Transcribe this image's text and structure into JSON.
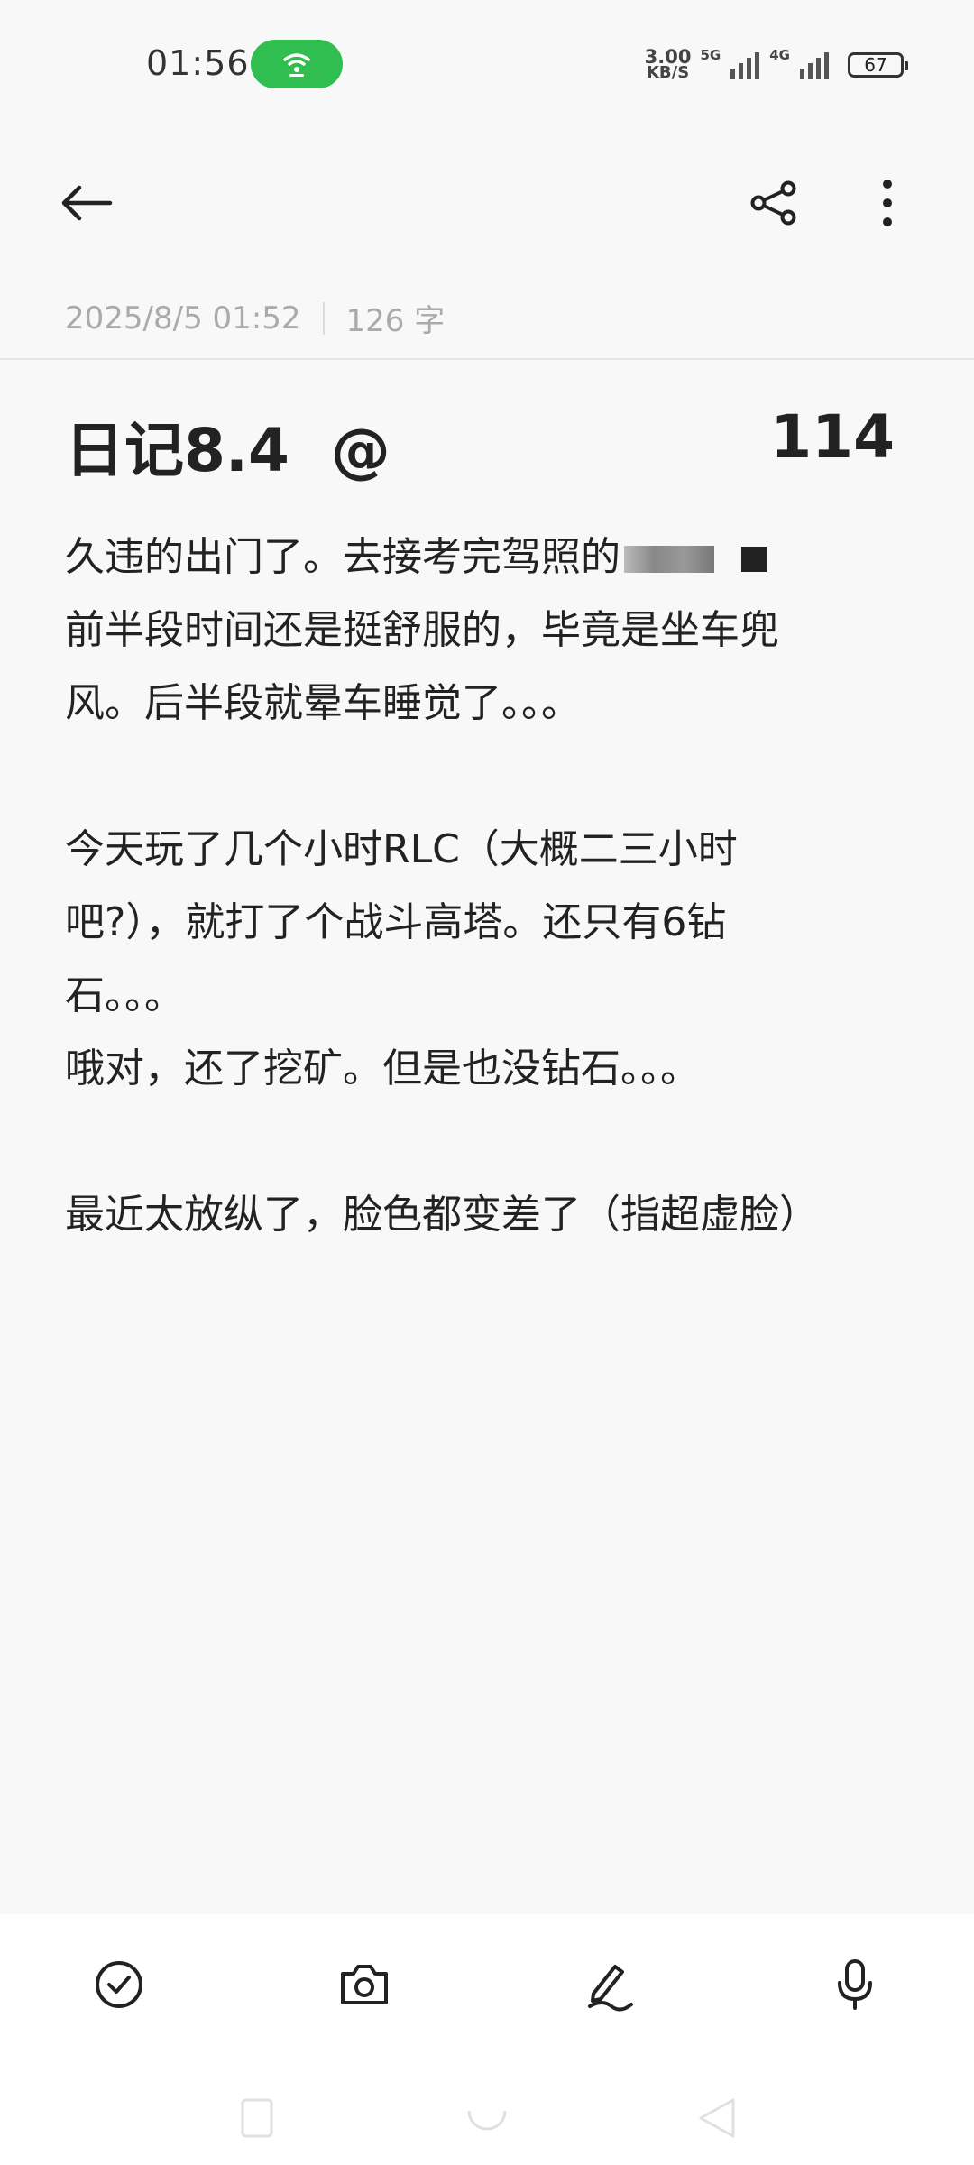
{
  "status_bar": {
    "time": "01:56",
    "speed_value": "3.00",
    "speed_unit": "KB/S",
    "net1": "5G",
    "net2": "4G",
    "battery": "67"
  },
  "note": {
    "date": "2025/8/5 01:52",
    "word_count": "126 字",
    "title": "日记8.4  @",
    "title_number": "114",
    "lines": [
      "久违的出门了。去接考完驾照的",
      "前半段时间还是挺舒服的，毕竟是坐车兜",
      "风。后半段就晕车睡觉了。。。",
      "",
      "今天玩了几个小时RLC（大概二三小时",
      "吧?），就打了个战斗高塔。还只有6钻",
      "石。。。",
      "哦对，还了挖矿。但是也没钻石。。。",
      "",
      "最近太放纵了，脸色都变差了（指超虚脸）"
    ]
  },
  "icons": {
    "hotspot": "hotspot-icon",
    "back": "back-arrow-icon",
    "share": "share-icon",
    "more": "more-vertical-icon",
    "check": "checklist-icon",
    "camera": "camera-icon",
    "pen": "handwriting-icon",
    "mic": "microphone-icon"
  },
  "colors": {
    "hotspot_green": "#2fbe4f",
    "background": "#f8f8f8",
    "text": "#222222",
    "meta_text": "#aaaaaa"
  }
}
